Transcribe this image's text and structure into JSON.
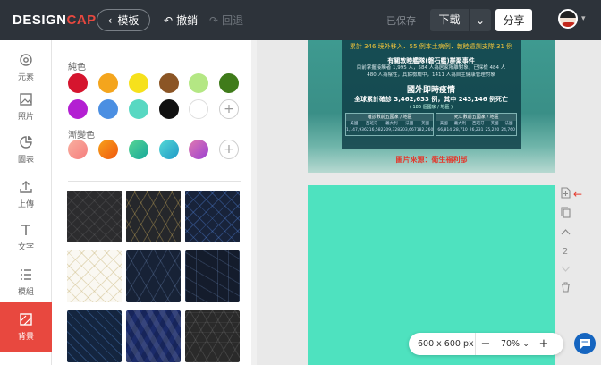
{
  "topbar": {
    "logo_main": "DESIGN",
    "logo_accent": "CAP",
    "back_label": "模板",
    "undo_label": "撤銷",
    "redo_label": "回退",
    "saved_label": "已保存",
    "download_label": "下載",
    "share_label": "分享"
  },
  "sidebar": {
    "items": [
      {
        "label": "元素",
        "icon": "elements-icon"
      },
      {
        "label": "照片",
        "icon": "photo-icon"
      },
      {
        "label": "圖表",
        "icon": "chart-icon"
      },
      {
        "label": "上傳",
        "icon": "upload-icon"
      },
      {
        "label": "文字",
        "icon": "text-icon"
      },
      {
        "label": "模組",
        "icon": "modules-icon"
      },
      {
        "label": "背景",
        "icon": "background-icon"
      }
    ],
    "active": "背景"
  },
  "panel": {
    "solid_title": "純色",
    "gradient_title": "漸變色",
    "solid_colors": [
      "#d5152e",
      "#f4a51d",
      "#f6e11c",
      "#8b5525",
      "#b4e784",
      "#3f7b1a",
      "#b31fd2",
      "#4b8fe2",
      "#58d8c2",
      "#111111",
      "#ffffff"
    ],
    "gradient_colors": [
      "#f5a08a",
      "#f27c10",
      "#33c39a",
      "#27b7c9",
      "#c15fc7"
    ],
    "add_symbol": "+",
    "pattern_colors": [
      "#2c2c2e",
      "#25272b",
      "#18233a",
      "#faf8f2",
      "#172236",
      "#141c2c",
      "#14253f",
      "#1b2b6a",
      "#2a2a2a"
    ]
  },
  "canvas": {
    "infographic": {
      "line1": "累計 346 境外移入．55 例本土病例．敦睦遠訓支隊 31 例",
      "heading1": "有關敦睦艦隊(磐石艦)群聚事件",
      "sub1": "目前掌握接觸者 1,995 人，584 人為居家隔離對象，已採檢 484 人",
      "sub2": "480 人為陰性，其餘檢驗中，1411 人為自主健康管理對象",
      "heading2": "國外即時疫情",
      "line2": "全球累計確診 3,462,633 例，其中 243,146 例死亡",
      "line3": "( 186 個國家 / 地區 )",
      "table1_title": "確診數前五國家 / 地區",
      "table1_cols": [
        "美國",
        "西班牙",
        "義大利",
        "法國",
        "英國"
      ],
      "table1_vals": [
        "1,147,936",
        "216,582",
        "209,328",
        "203,667",
        "182,260"
      ],
      "table2_title": "死亡數前五國家 / 地區",
      "table2_cols": [
        "美國",
        "義大利",
        "西班牙",
        "英國",
        "法國"
      ],
      "table2_vals": [
        "66,814",
        "28,710",
        "26,231",
        "25,220",
        "24,760"
      ]
    },
    "source": "圖片來源：衛生福利部",
    "page_number": "2"
  },
  "zoombar": {
    "size": "600 x 600 px",
    "minus": "−",
    "zoom": "70%",
    "plus": "+"
  }
}
